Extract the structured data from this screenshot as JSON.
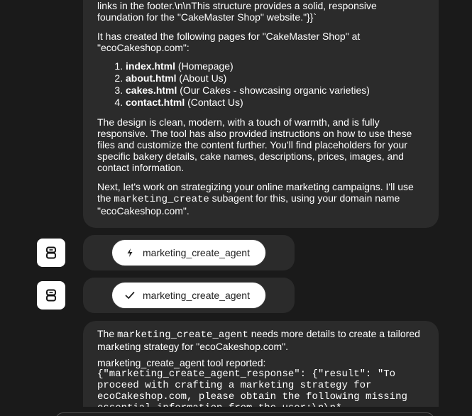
{
  "message_top": {
    "partial_line_1": "links in the footer.\\n\\nThis structure provides a solid, responsive",
    "partial_line_2": "foundation for the \"CakeMaster Shop\" website.\"}}`",
    "intro": "It has created the following pages for \"CakeMaster Shop\" at \"ecoCakeshop.com\":",
    "pages": [
      {
        "file": "index.html",
        "desc": " (Homepage)"
      },
      {
        "file": "about.html",
        "desc": " (About Us)"
      },
      {
        "file": "cakes.html",
        "desc": " (Our Cakes - showcasing organic varieties)"
      },
      {
        "file": "contact.html",
        "desc": " (Contact Us)"
      }
    ],
    "design_paragraph": "The design is clean, modern, with a touch of warmth, and is fully responsive. The tool has also provided instructions on how to use these files and customize the content further. You'll find placeholders for your specific bakery details, cake names, descriptions, prices, images, and contact information.",
    "next_before": "Next, let's work on strategizing your online marketing campaigns. I'll use the ",
    "next_code": "marketing_create",
    "next_after": " subagent for this, using your domain name \"ecoCakeshop.com\"."
  },
  "tool_calls": [
    {
      "status": "running",
      "icon": "lightning-icon",
      "label": "marketing_create_agent"
    },
    {
      "status": "done",
      "icon": "check-icon",
      "label": "marketing_create_agent"
    }
  ],
  "message_bottom": {
    "intro_before": "The ",
    "intro_code": "marketing_create_agent",
    "intro_after": " needs more details to create a tailored marketing strategy for \"ecoCakeshop.com\".",
    "report_heading": "marketing_create_agent tool reported:",
    "report_body": "{\"marketing_create_agent_response\": {\"result\": \"To\nproceed with crafting a marketing strategy for\necoCakeshop.com, please obtain the following missing\nessential information from the user:\\n\\n*"
  },
  "colors": {
    "background": "#1a1a1a",
    "bubble": "#2b2b2b",
    "chip": "#ffffff",
    "text": "#ffffff"
  }
}
